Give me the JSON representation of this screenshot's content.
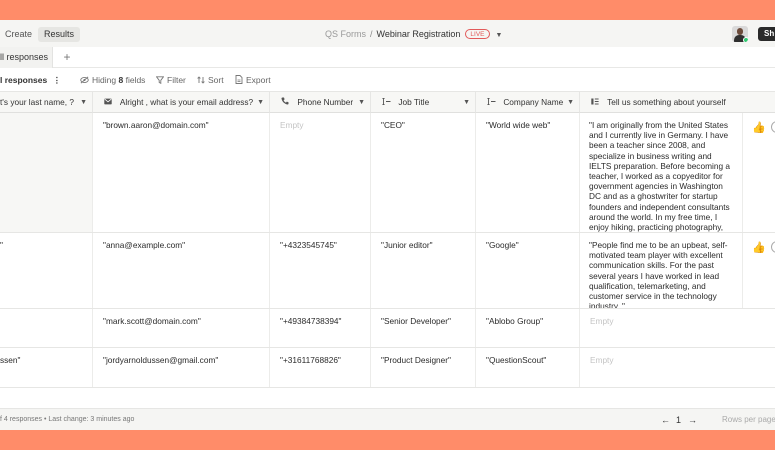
{
  "nav": {
    "create_label": "Create",
    "results_label": "Results",
    "breadcrumb_root": "QS Forms",
    "breadcrumb_sep": "/",
    "form_name": "Webinar Registration",
    "live_badge": "LIVE",
    "share_label": "Sh"
  },
  "tabs": {
    "view_tab_label": "ll responses",
    "add_tab_label": "+"
  },
  "toolbar": {
    "view_label": "l responses",
    "more_label": "⋮",
    "hiding_prefix": "Hiding",
    "hiding_count": "8",
    "hiding_suffix": "fields",
    "filter_label": "Filter",
    "sort_label": "Sort",
    "export_label": "Export"
  },
  "columns": [
    {
      "label": "t's your last name, ?",
      "icon": ""
    },
    {
      "label": "Alright , what is your email address?",
      "icon": "email-icon"
    },
    {
      "label": "Phone Number",
      "icon": "phone-icon"
    },
    {
      "label": "Job Title",
      "icon": "text-cursor-icon"
    },
    {
      "label": "Company Name",
      "icon": "text-cursor-icon"
    },
    {
      "label": "Tell us something about yourself",
      "icon": "paragraph-icon"
    }
  ],
  "rows": [
    {
      "last_name": "",
      "email": "\"brown.aaron@domain.com\"",
      "phone": "Empty",
      "job": "\"CEO\"",
      "company": "\"World wide web\"",
      "about": "\"I am originally from the United States and I currently live in Germany. I have been a teacher since 2008, and specialize in business writing and IELTS preparation. Before becoming a teacher, I worked as a copyeditor for government agencies in Washington DC and as a ghostwriter for startup founders and independent consultants around the world. In my free time, I enjoy hiking, practicing photography, and exploring the city by bike.\"",
      "reaction": "👍"
    },
    {
      "last_name": "\"",
      "email": "\"anna@example.com\"",
      "phone": "\"+4323545745\"",
      "job": "\"Junior editor\"",
      "company": "\"Google\"",
      "about": "\"People find me to be an upbeat, self-motivated team player with excellent communication skills. For the past several years I have worked in lead qualification, telemarketing, and customer service in the technology industry. \"",
      "reaction": "👍"
    },
    {
      "last_name": "",
      "email": "\"mark.scott@domain.com\"",
      "phone": "\"+49384738394\"",
      "job": "\"Senior Developer\"",
      "company": "\"Ablobo Group\"",
      "about": "Empty",
      "reaction": ""
    },
    {
      "last_name": "ssen\"",
      "email": "\"jordyarnoldussen@gmail.com\"",
      "phone": "\"+31611768826\"",
      "job": "\"Product Designer\"",
      "company": "\"QuestionScout\"",
      "about": "Empty",
      "reaction": ""
    }
  ],
  "footer": {
    "summary": "f 4 responses  •  Last change: 3 minutes ago",
    "prev_label": "←",
    "page": "1",
    "next_label": "→",
    "rows_per_page_label": "Rows per page"
  },
  "colors": {
    "page_background": "#FF8C69",
    "live_badge": "#E25A5A",
    "status_online": "#2ECC71"
  }
}
